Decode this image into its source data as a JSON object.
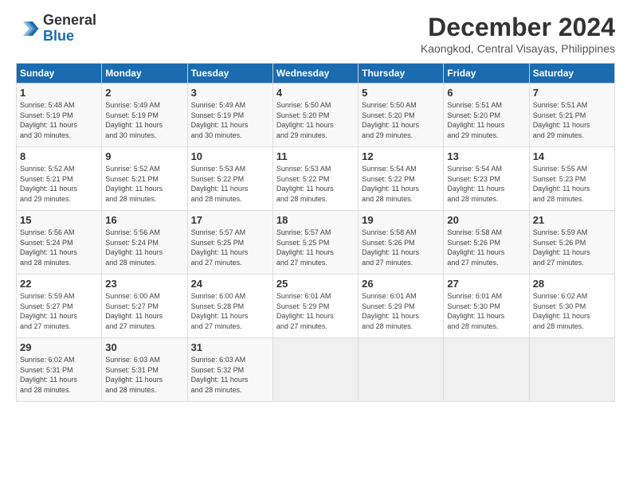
{
  "header": {
    "logo_line1": "General",
    "logo_line2": "Blue",
    "title": "December 2024",
    "location": "Kaongkod, Central Visayas, Philippines"
  },
  "calendar": {
    "headers": [
      "Sunday",
      "Monday",
      "Tuesday",
      "Wednesday",
      "Thursday",
      "Friday",
      "Saturday"
    ],
    "weeks": [
      [
        {
          "num": "",
          "info": ""
        },
        {
          "num": "2",
          "info": "Sunrise: 5:49 AM\nSunset: 5:19 PM\nDaylight: 11 hours\nand 30 minutes."
        },
        {
          "num": "3",
          "info": "Sunrise: 5:49 AM\nSunset: 5:19 PM\nDaylight: 11 hours\nand 30 minutes."
        },
        {
          "num": "4",
          "info": "Sunrise: 5:50 AM\nSunset: 5:20 PM\nDaylight: 11 hours\nand 29 minutes."
        },
        {
          "num": "5",
          "info": "Sunrise: 5:50 AM\nSunset: 5:20 PM\nDaylight: 11 hours\nand 29 minutes."
        },
        {
          "num": "6",
          "info": "Sunrise: 5:51 AM\nSunset: 5:20 PM\nDaylight: 11 hours\nand 29 minutes."
        },
        {
          "num": "7",
          "info": "Sunrise: 5:51 AM\nSunset: 5:21 PM\nDaylight: 11 hours\nand 29 minutes."
        }
      ],
      [
        {
          "num": "1",
          "info": "Sunrise: 5:48 AM\nSunset: 5:19 PM\nDaylight: 11 hours\nand 30 minutes."
        },
        {
          "num": "",
          "info": ""
        },
        {
          "num": "",
          "info": ""
        },
        {
          "num": "",
          "info": ""
        },
        {
          "num": "",
          "info": ""
        },
        {
          "num": "",
          "info": ""
        },
        {
          "num": "",
          "info": ""
        }
      ],
      [
        {
          "num": "8",
          "info": "Sunrise: 5:52 AM\nSunset: 5:21 PM\nDaylight: 11 hours\nand 29 minutes."
        },
        {
          "num": "9",
          "info": "Sunrise: 5:52 AM\nSunset: 5:21 PM\nDaylight: 11 hours\nand 28 minutes."
        },
        {
          "num": "10",
          "info": "Sunrise: 5:53 AM\nSunset: 5:22 PM\nDaylight: 11 hours\nand 28 minutes."
        },
        {
          "num": "11",
          "info": "Sunrise: 5:53 AM\nSunset: 5:22 PM\nDaylight: 11 hours\nand 28 minutes."
        },
        {
          "num": "12",
          "info": "Sunrise: 5:54 AM\nSunset: 5:22 PM\nDaylight: 11 hours\nand 28 minutes."
        },
        {
          "num": "13",
          "info": "Sunrise: 5:54 AM\nSunset: 5:23 PM\nDaylight: 11 hours\nand 28 minutes."
        },
        {
          "num": "14",
          "info": "Sunrise: 5:55 AM\nSunset: 5:23 PM\nDaylight: 11 hours\nand 28 minutes."
        }
      ],
      [
        {
          "num": "15",
          "info": "Sunrise: 5:56 AM\nSunset: 5:24 PM\nDaylight: 11 hours\nand 28 minutes."
        },
        {
          "num": "16",
          "info": "Sunrise: 5:56 AM\nSunset: 5:24 PM\nDaylight: 11 hours\nand 28 minutes."
        },
        {
          "num": "17",
          "info": "Sunrise: 5:57 AM\nSunset: 5:25 PM\nDaylight: 11 hours\nand 27 minutes."
        },
        {
          "num": "18",
          "info": "Sunrise: 5:57 AM\nSunset: 5:25 PM\nDaylight: 11 hours\nand 27 minutes."
        },
        {
          "num": "19",
          "info": "Sunrise: 5:58 AM\nSunset: 5:26 PM\nDaylight: 11 hours\nand 27 minutes."
        },
        {
          "num": "20",
          "info": "Sunrise: 5:58 AM\nSunset: 5:26 PM\nDaylight: 11 hours\nand 27 minutes."
        },
        {
          "num": "21",
          "info": "Sunrise: 5:59 AM\nSunset: 5:26 PM\nDaylight: 11 hours\nand 27 minutes."
        }
      ],
      [
        {
          "num": "22",
          "info": "Sunrise: 5:59 AM\nSunset: 5:27 PM\nDaylight: 11 hours\nand 27 minutes."
        },
        {
          "num": "23",
          "info": "Sunrise: 6:00 AM\nSunset: 5:27 PM\nDaylight: 11 hours\nand 27 minutes."
        },
        {
          "num": "24",
          "info": "Sunrise: 6:00 AM\nSunset: 5:28 PM\nDaylight: 11 hours\nand 27 minutes."
        },
        {
          "num": "25",
          "info": "Sunrise: 6:01 AM\nSunset: 5:29 PM\nDaylight: 11 hours\nand 27 minutes."
        },
        {
          "num": "26",
          "info": "Sunrise: 6:01 AM\nSunset: 5:29 PM\nDaylight: 11 hours\nand 28 minutes."
        },
        {
          "num": "27",
          "info": "Sunrise: 6:01 AM\nSunset: 5:30 PM\nDaylight: 11 hours\nand 28 minutes."
        },
        {
          "num": "28",
          "info": "Sunrise: 6:02 AM\nSunset: 5:30 PM\nDaylight: 11 hours\nand 28 minutes."
        }
      ],
      [
        {
          "num": "29",
          "info": "Sunrise: 6:02 AM\nSunset: 5:31 PM\nDaylight: 11 hours\nand 28 minutes."
        },
        {
          "num": "30",
          "info": "Sunrise: 6:03 AM\nSunset: 5:31 PM\nDaylight: 11 hours\nand 28 minutes."
        },
        {
          "num": "31",
          "info": "Sunrise: 6:03 AM\nSunset: 5:32 PM\nDaylight: 11 hours\nand 28 minutes."
        },
        {
          "num": "",
          "info": ""
        },
        {
          "num": "",
          "info": ""
        },
        {
          "num": "",
          "info": ""
        },
        {
          "num": "",
          "info": ""
        }
      ]
    ]
  }
}
